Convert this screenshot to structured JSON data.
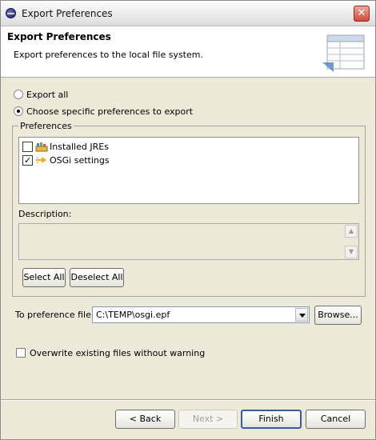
{
  "window": {
    "title": "Export Preferences"
  },
  "banner": {
    "title": "Export Preferences",
    "description": "Export preferences to the local file system."
  },
  "options": {
    "export_all": "Export all",
    "choose_specific": "Choose specific preferences to export",
    "selected": "choose_specific"
  },
  "preferences": {
    "group_label": "Preferences",
    "items": [
      {
        "label": "Installed JREs",
        "checked": false,
        "icon": "jre-library-icon"
      },
      {
        "label": "OSGi settings",
        "checked": true,
        "icon": "osgi-arrow-icon"
      }
    ],
    "description_label": "Description:",
    "select_all": "Select All",
    "deselect_all": "Deselect All"
  },
  "file": {
    "label": "To preference file:",
    "value": "C:\\TEMP\\osgi.epf",
    "browse": "Browse..."
  },
  "overwrite": {
    "label": "Overwrite existing files without warning",
    "checked": false
  },
  "footer": {
    "back": "< Back",
    "next": "Next >",
    "finish": "Finish",
    "cancel": "Cancel"
  }
}
